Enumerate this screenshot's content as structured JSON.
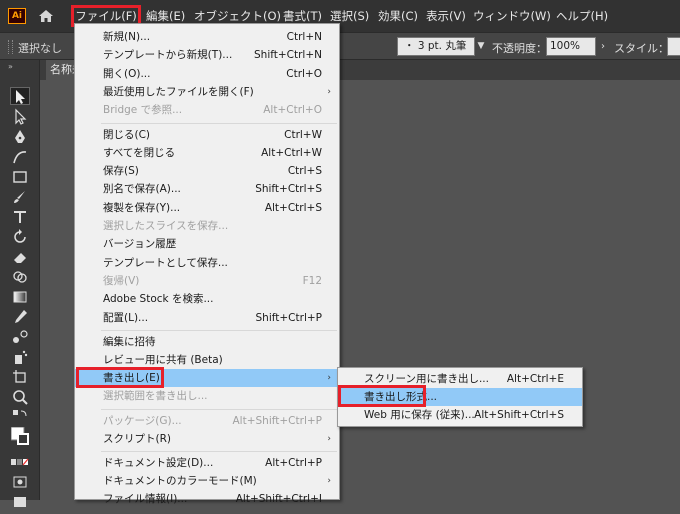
{
  "app": {
    "logo": "Ai"
  },
  "menubar": {
    "items": [
      "ファイル(F)",
      "編集(E)",
      "オブジェクト(O)",
      "書式(T)",
      "選択(S)",
      "効果(C)",
      "表示(V)",
      "ウィンドウ(W)",
      "ヘルプ(H)"
    ]
  },
  "controlbar": {
    "selection": "選択なし",
    "stroke": "・ 3 pt. 丸筆",
    "opacity_label": "不透明度：",
    "opacity_value": "100%",
    "style_label": "スタイル："
  },
  "document_tab": "名称未",
  "file_menu": {
    "items": [
      {
        "label": "新規(N)...",
        "shortcut": "Ctrl+N"
      },
      {
        "label": "テンプレートから新規(T)...",
        "shortcut": "Shift+Ctrl+N"
      },
      {
        "label": "開く(O)...",
        "shortcut": "Ctrl+O"
      },
      {
        "label": "最近使用したファイルを開く(F)",
        "shortcut": ""
      },
      {
        "label": "Bridge で参照...",
        "shortcut": "Alt+Ctrl+O"
      },
      {
        "label": "閉じる(C)",
        "shortcut": "Ctrl+W"
      },
      {
        "label": "すべてを閉じる",
        "shortcut": "Alt+Ctrl+W"
      },
      {
        "label": "保存(S)",
        "shortcut": "Ctrl+S"
      },
      {
        "label": "別名で保存(A)...",
        "shortcut": "Shift+Ctrl+S"
      },
      {
        "label": "複製を保存(Y)...",
        "shortcut": "Alt+Ctrl+S"
      },
      {
        "label": "選択したスライスを保存...",
        "shortcut": ""
      },
      {
        "label": "バージョン履歴",
        "shortcut": ""
      },
      {
        "label": "テンプレートとして保存...",
        "shortcut": ""
      },
      {
        "label": "復帰(V)",
        "shortcut": "F12"
      },
      {
        "label": "Adobe Stock を検索...",
        "shortcut": ""
      },
      {
        "label": "配置(L)...",
        "shortcut": "Shift+Ctrl+P"
      },
      {
        "label": "編集に招待",
        "shortcut": ""
      },
      {
        "label": "レビュー用に共有 (Beta)",
        "shortcut": ""
      },
      {
        "label": "書き出し(E)",
        "shortcut": ""
      },
      {
        "label": "選択範囲を書き出し...",
        "shortcut": ""
      },
      {
        "label": "パッケージ(G)...",
        "shortcut": "Alt+Shift+Ctrl+P"
      },
      {
        "label": "スクリプト(R)",
        "shortcut": ""
      },
      {
        "label": "ドキュメント設定(D)...",
        "shortcut": "Alt+Ctrl+P"
      },
      {
        "label": "ドキュメントのカラーモード(M)",
        "shortcut": ""
      },
      {
        "label": "ファイル情報(I)...",
        "shortcut": "Alt+Shift+Ctrl+I"
      }
    ]
  },
  "export_submenu": {
    "items": [
      {
        "label": "スクリーン用に書き出し...",
        "shortcut": "Alt+Ctrl+E"
      },
      {
        "label": "書き出し形式...",
        "shortcut": ""
      },
      {
        "label": "Web 用に保存 (従来)...",
        "shortcut": "Alt+Shift+Ctrl+S"
      }
    ]
  },
  "colors": {
    "menu_highlight": "#91c9f7",
    "callout_red": "#e6202a",
    "logo_orange": "#ff9a00"
  }
}
